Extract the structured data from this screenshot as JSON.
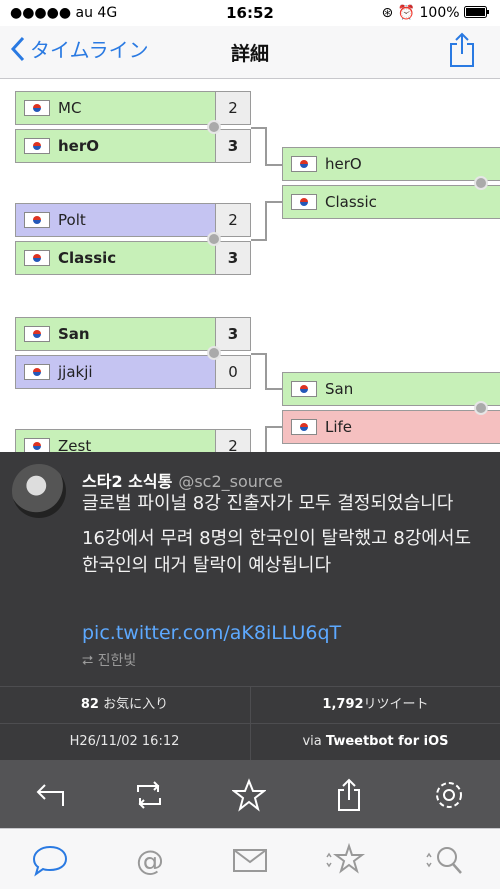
{
  "status": {
    "carrier": "●●●●● au  4G",
    "time": "16:52",
    "battery": "100%",
    "icons": [
      "rotation-lock-icon",
      "alarm-icon",
      "battery-icon"
    ]
  },
  "nav": {
    "back_label": "タイムライン",
    "title": "詳細",
    "share_icon": "share-icon"
  },
  "bracket": {
    "matches": [
      {
        "top": {
          "name": "MC",
          "score": "2"
        },
        "bottom": {
          "name": "herO",
          "score": "3"
        }
      },
      {
        "top": {
          "name": "Polt",
          "score": "2"
        },
        "bottom": {
          "name": "Classic",
          "score": "3"
        }
      },
      {
        "top": {
          "name": "San",
          "score": "3"
        },
        "bottom": {
          "name": "jjakji",
          "score": "0"
        }
      },
      {
        "top": {
          "name": "Zest",
          "score": "2"
        }
      }
    ],
    "next": [
      {
        "top": {
          "name": "herO"
        },
        "bottom": {
          "name": "Classic"
        }
      },
      {
        "top": {
          "name": "San"
        },
        "bottom": {
          "name": "Life"
        }
      }
    ],
    "colors": {
      "win": "#c7f0b8",
      "loss_purple": "#c5c4f2",
      "loss_pink": "#f5c0c0"
    }
  },
  "tweet": {
    "author": "스타2 소식통",
    "handle": "@sc2_source",
    "line1": "글로벌 파이널 8강 진출자가 모두 결정되었습니다",
    "line2": "16강에서 무려 8명의 한국인이 탈락했고 8강에서도 한국인의 대거 탈락이 예상됩니다",
    "link": "pic.twitter.com/aK8iLLU6qT",
    "retweeted_by": "진한빛",
    "favorites_count": "82",
    "favorites_label": "お気に入り",
    "retweets_count": "1,792",
    "retweets_label": "リツイート",
    "date": "H26/11/02 16:12",
    "via_label": "via",
    "client": "Tweetbot for iOS"
  },
  "toolbar": [
    "reply-icon",
    "retweet-icon",
    "favorite-icon",
    "share-icon",
    "settings-icon"
  ],
  "tabbar": [
    "timeline-icon",
    "mentions-icon",
    "messages-icon",
    "favorites-icon",
    "search-icon"
  ]
}
